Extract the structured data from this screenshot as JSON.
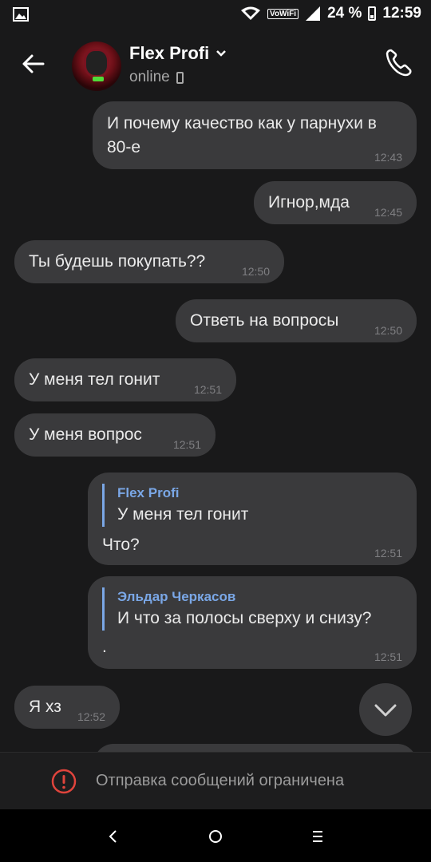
{
  "status_bar": {
    "wifi_label": "VoWiFi",
    "battery": "24 %",
    "time": "12:59"
  },
  "header": {
    "name": "Flex Profi",
    "status": "online"
  },
  "messages": [
    {
      "side": "out",
      "text": "И почему качество как у парнухи в 80-е",
      "time": "12:43"
    },
    {
      "side": "out",
      "text": "Игнор,мда",
      "time": "12:45"
    },
    {
      "side": "in",
      "text": "Ты будешь покупать??",
      "time": "12:50"
    },
    {
      "side": "out",
      "text": "Ответь на вопросы",
      "time": "12:50"
    },
    {
      "side": "in",
      "text": "У меня тел гонит",
      "time": "12:51"
    },
    {
      "side": "in",
      "text": "У меня вопрос",
      "time": "12:51"
    },
    {
      "side": "out",
      "reply_author": "Flex Profi",
      "reply_text": "У меня тел гонит",
      "text": "Что?",
      "time": "12:51"
    },
    {
      "side": "out",
      "reply_author": "Эльдар Черкасов",
      "reply_text": "И что за полосы сверху и снизу?",
      "text": ".",
      "time": "12:51"
    },
    {
      "side": "in",
      "text": "Я хз",
      "time": "12:52"
    }
  ],
  "footer": {
    "restricted_text": "Отправка сообщений ограничена"
  },
  "colors": {
    "background": "#19191a",
    "bubble": "#3a3a3c",
    "reply_accent": "#7aa7e6",
    "warning": "#e0443c"
  }
}
